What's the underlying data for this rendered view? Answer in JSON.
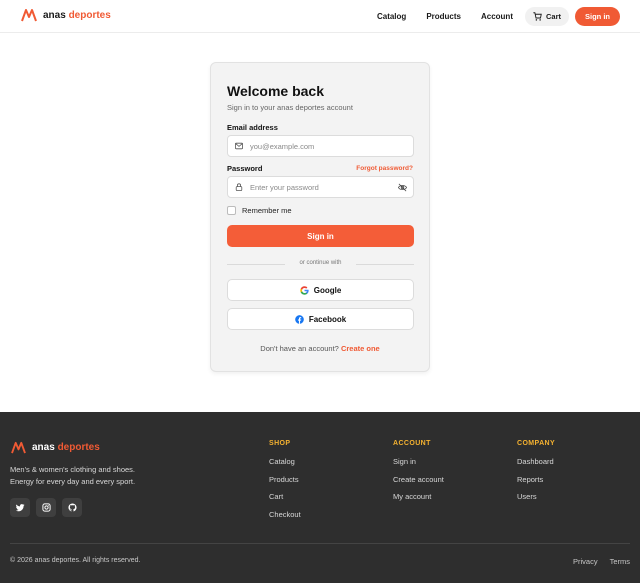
{
  "brand": {
    "name_part1": "anas",
    "name_part2": "deportes",
    "accent": "#f05a34"
  },
  "header": {
    "nav": [
      "Catalog",
      "Products",
      "Account"
    ],
    "cart_label": "Cart",
    "signin_label": "Sign in"
  },
  "login": {
    "title": "Welcome back",
    "subtitle": "Sign in to your anas deportes account",
    "email_label": "Email address",
    "email_placeholder": "you@example.com",
    "password_label": "Password",
    "forgot_label": "Forgot password?",
    "password_placeholder": "Enter your password",
    "remember_label": "Remember me",
    "submit_label": "Sign in",
    "divider_text": "or continue with",
    "google_label": "Google",
    "facebook_label": "Facebook",
    "no_account_text": "Don't have an account?",
    "create_link": "Create one"
  },
  "footer": {
    "tagline_line1": "Men's & women's clothing and shoes.",
    "tagline_line2": "Energy for every day and every sport.",
    "shop": {
      "heading": "SHOP",
      "items": [
        "Catalog",
        "Products",
        "Cart",
        "Checkout"
      ]
    },
    "account": {
      "heading": "ACCOUNT",
      "items": [
        "Sign in",
        "Create account",
        "My account"
      ]
    },
    "company": {
      "heading": "COMPANY",
      "items": [
        "Dashboard",
        "Reports",
        "Users"
      ]
    },
    "copyright": "© 2026 anas deportes. All rights reserved.",
    "legal": [
      "Privacy",
      "Terms"
    ]
  }
}
